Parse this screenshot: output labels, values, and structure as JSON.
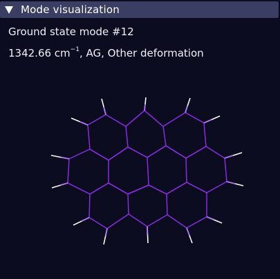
{
  "panel": {
    "title": "Mode visualization"
  },
  "info": {
    "mode_label": "Ground state mode #12",
    "frequency": "1342.66 cm",
    "frequency_sup": "−1",
    "frequency_rest": ", AG, Other deformation"
  },
  "colors": {
    "background": "#0b0c1f",
    "header": "#3b3e63",
    "bond": "#8a2be2",
    "hydrogen_bond": "#ffffff"
  }
}
